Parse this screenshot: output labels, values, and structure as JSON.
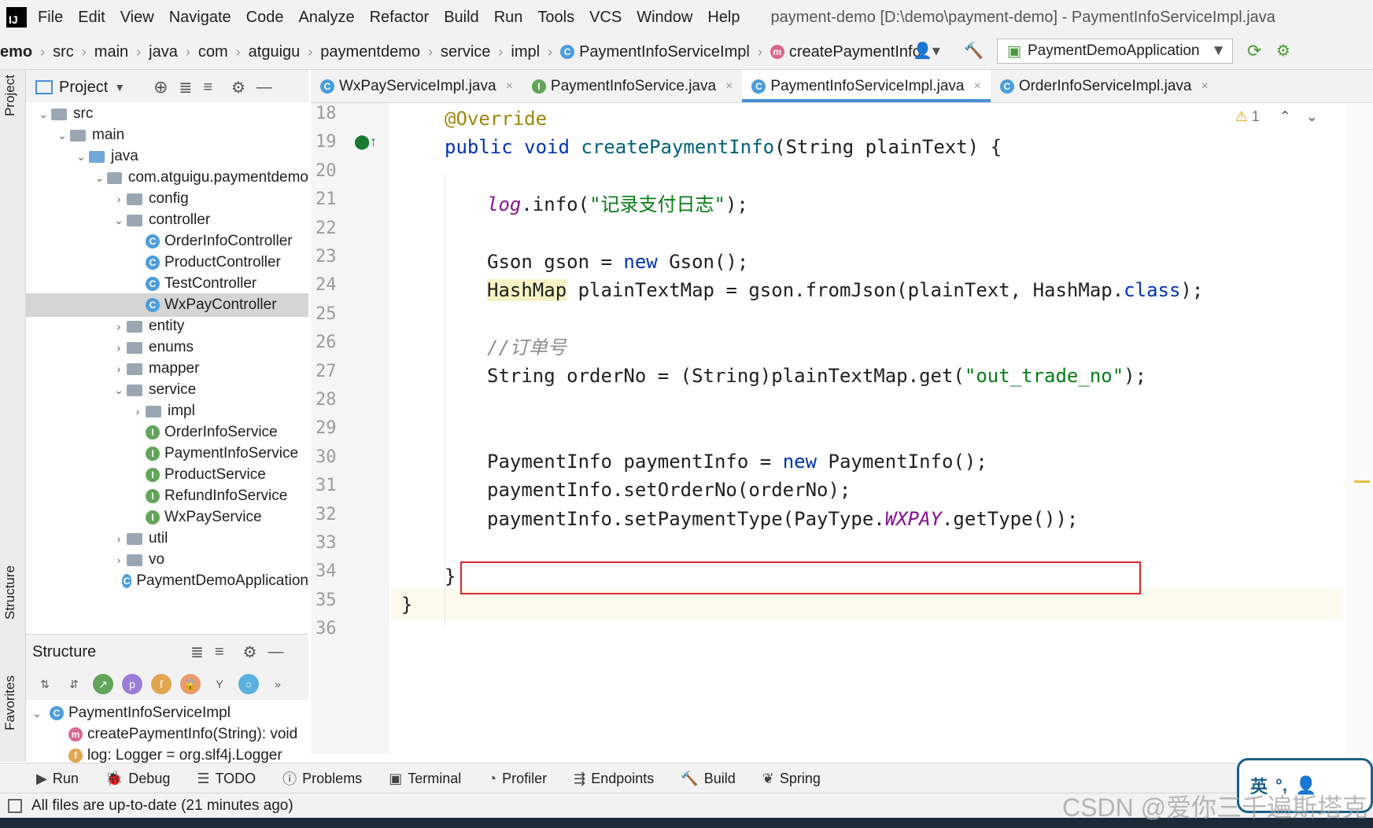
{
  "app": {
    "window_title": "payment-demo [D:\\demo\\payment-demo] - PaymentInfoServiceImpl.java",
    "logo_text": "IJ"
  },
  "menu": [
    "File",
    "Edit",
    "View",
    "Navigate",
    "Code",
    "Analyze",
    "Refactor",
    "Build",
    "Run",
    "Tools",
    "VCS",
    "Window",
    "Help"
  ],
  "breadcrumb": [
    "emo",
    "src",
    "main",
    "java",
    "com",
    "atguigu",
    "paymentdemo",
    "service",
    "impl",
    "PaymentInfoServiceImpl",
    "createPaymentInfo"
  ],
  "run_config": "PaymentDemoApplication",
  "project_panel": {
    "title": "Project",
    "tree": [
      {
        "label": "src",
        "indent": 1,
        "chev": "v",
        "icon": "folder"
      },
      {
        "label": "main",
        "indent": 2,
        "chev": "v",
        "icon": "folder"
      },
      {
        "label": "java",
        "indent": 3,
        "chev": "v",
        "icon": "folder-blue"
      },
      {
        "label": "com.atguigu.paymentdemo",
        "indent": 4,
        "chev": "v",
        "icon": "folder"
      },
      {
        "label": "config",
        "indent": 5,
        "chev": ">",
        "icon": "folder"
      },
      {
        "label": "controller",
        "indent": 5,
        "chev": "v",
        "icon": "folder"
      },
      {
        "label": "OrderInfoController",
        "indent": 6,
        "chev": "",
        "icon": "class"
      },
      {
        "label": "ProductController",
        "indent": 6,
        "chev": "",
        "icon": "class"
      },
      {
        "label": "TestController",
        "indent": 6,
        "chev": "",
        "icon": "class"
      },
      {
        "label": "WxPayController",
        "indent": 6,
        "chev": "",
        "icon": "class",
        "selected": true
      },
      {
        "label": "entity",
        "indent": 5,
        "chev": ">",
        "icon": "folder"
      },
      {
        "label": "enums",
        "indent": 5,
        "chev": ">",
        "icon": "folder"
      },
      {
        "label": "mapper",
        "indent": 5,
        "chev": ">",
        "icon": "folder"
      },
      {
        "label": "service",
        "indent": 5,
        "chev": "v",
        "icon": "folder"
      },
      {
        "label": "impl",
        "indent": 6,
        "chev": ">",
        "icon": "folder"
      },
      {
        "label": "OrderInfoService",
        "indent": 6,
        "chev": "",
        "icon": "interface"
      },
      {
        "label": "PaymentInfoService",
        "indent": 6,
        "chev": "",
        "icon": "interface"
      },
      {
        "label": "ProductService",
        "indent": 6,
        "chev": "",
        "icon": "interface"
      },
      {
        "label": "RefundInfoService",
        "indent": 6,
        "chev": "",
        "icon": "interface"
      },
      {
        "label": "WxPayService",
        "indent": 6,
        "chev": "",
        "icon": "interface"
      },
      {
        "label": "util",
        "indent": 5,
        "chev": ">",
        "icon": "folder"
      },
      {
        "label": "vo",
        "indent": 5,
        "chev": ">",
        "icon": "folder"
      },
      {
        "label": "PaymentDemoApplication",
        "indent": 5,
        "chev": "",
        "icon": "class"
      }
    ]
  },
  "structure_panel": {
    "title": "Structure",
    "items": [
      {
        "label": "PaymentInfoServiceImpl",
        "icon": "c"
      },
      {
        "label": "createPaymentInfo(String): void",
        "icon": "m"
      },
      {
        "label": "log: Logger = org.slf4j.Logger",
        "icon": "f"
      }
    ]
  },
  "editor_tabs": [
    {
      "label": "WxPayServiceImpl.java",
      "icon": "c"
    },
    {
      "label": "PaymentInfoService.java",
      "icon": "i"
    },
    {
      "label": "PaymentInfoServiceImpl.java",
      "icon": "c",
      "active": true
    },
    {
      "label": "OrderInfoServiceImpl.java",
      "icon": "c"
    }
  ],
  "inspection": "1",
  "line_numbers": [
    "18",
    "19",
    "20",
    "21",
    "22",
    "23",
    "24",
    "25",
    "26",
    "27",
    "28",
    "29",
    "30",
    "31",
    "32",
    "33",
    "34",
    "35",
    "36"
  ],
  "tool_windows": [
    "Run",
    "Debug",
    "TODO",
    "Problems",
    "Terminal",
    "Profiler",
    "Endpoints",
    "Build",
    "Spring"
  ],
  "side_tabs": [
    "Project",
    "Structure",
    "Favorites"
  ],
  "status_text": "All files are up-to-date (21 minutes ago)",
  "watermark": "CSDN @爱你三千遍斯塔克",
  "ime_label": "英",
  "colors": {
    "accent": "#4a8fd6",
    "highlight_box": "#e0262b"
  }
}
